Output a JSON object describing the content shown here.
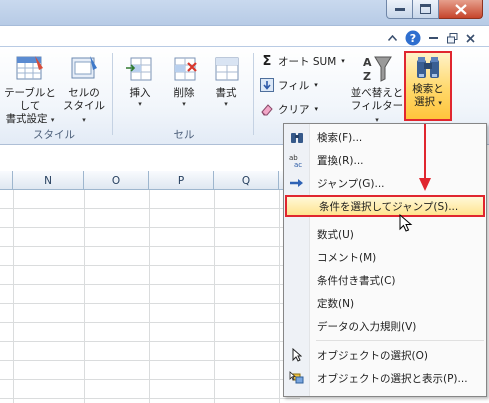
{
  "window": {
    "buttons": [
      "minimize-icon",
      "maximize-icon",
      "close-icon"
    ]
  },
  "ribbon_controls": [
    "caret-up-icon",
    "help-icon",
    "minimize-ribbon-icon",
    "restore-icon",
    "close-icon"
  ],
  "ribbon": {
    "style_group": {
      "label": "スタイル",
      "table_button": [
        "テーブルとして",
        "書式設定"
      ],
      "cell_style_button": [
        "セルの",
        "スタイル"
      ]
    },
    "cells_group": {
      "label": "セル",
      "insert": "挿入",
      "delete": "削除",
      "format": "書式"
    },
    "editing_group": {
      "autosum": "オート SUM",
      "fill": "フィル",
      "clear": "クリア",
      "sort_filter": [
        "並べ替えと",
        "フィルター"
      ],
      "find_select": [
        "検索と",
        "選択"
      ]
    }
  },
  "sheet": {
    "columns": [
      "N",
      "O",
      "P",
      "Q"
    ]
  },
  "menu": {
    "items": [
      {
        "label": "検索(F)...",
        "icon": "binoculars-icon"
      },
      {
        "label": "置換(R)...",
        "icon": "replace-icon"
      },
      {
        "label": "ジャンプ(G)...",
        "icon": "arrow-right-icon"
      },
      {
        "label": "条件を選択してジャンプ(S)...",
        "icon": "",
        "highlighted": true
      },
      {
        "label": "数式(U)",
        "icon": ""
      },
      {
        "label": "コメント(M)",
        "icon": ""
      },
      {
        "label": "条件付き書式(C)",
        "icon": ""
      },
      {
        "label": "定数(N)",
        "icon": ""
      },
      {
        "label": "データの入力規則(V)",
        "icon": ""
      },
      {
        "label": "オブジェクトの選択(O)",
        "icon": "pointer-icon"
      },
      {
        "label": "オブジェクトの選択と表示(P)...",
        "icon": "selection-pane-icon"
      }
    ]
  },
  "colors": {
    "highlight_border": "#e0262f",
    "highlight_fill": "#ffe48f",
    "ribbon_bg": "#f2f6fb"
  }
}
